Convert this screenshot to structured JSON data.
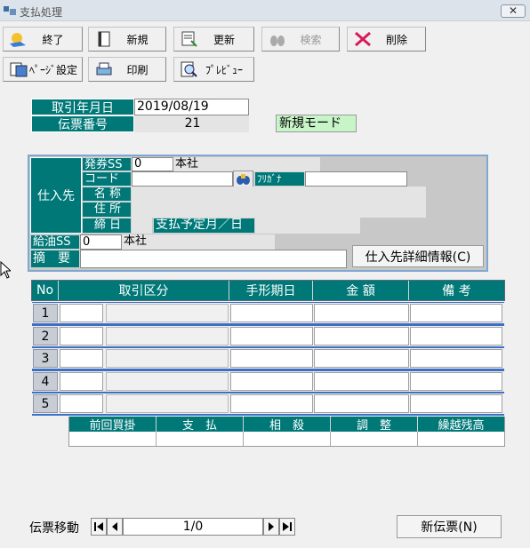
{
  "window": {
    "title": "支払処理",
    "close_label": "✕"
  },
  "toolbar": {
    "exit": "終了",
    "new": "新規",
    "update": "更新",
    "search": "検索",
    "delete": "削除",
    "page_setup": "ﾍﾟｰｼﾞ設定",
    "print": "印刷",
    "preview": "ﾌﾟﾚﾋﾞｭｰ"
  },
  "header": {
    "date_label": "取引年月日",
    "date_value": "2019/08/19",
    "slip_label": "伝票番号",
    "slip_value": "21",
    "mode": "新規モード"
  },
  "supplier": {
    "group_label": "仕入先",
    "issuer_ss_label": "発券SS",
    "issuer_ss_code": "0",
    "issuer_ss_name": "本社",
    "code_label": "コード",
    "code_value": "",
    "furigana_label": "ﾌﾘｶﾞﾅ",
    "furigana_value": "",
    "name_label": "名 称",
    "name_value": "",
    "address_label": "住 所",
    "address_value": "",
    "closing_label": "締 日",
    "closing_value": "",
    "payment_month_label": "支払予定月／日",
    "payment_month_value": "",
    "fuel_ss_label": "給油SS",
    "fuel_ss_code": "0",
    "fuel_ss_name": "本社",
    "memo_label": "摘　要",
    "memo_value": "",
    "detail_button": "仕入先詳細情報(C)"
  },
  "grid": {
    "headers": [
      "No",
      "取引区分",
      "手形期日",
      "金 額",
      "備 考"
    ],
    "rows": [
      {
        "no": "1"
      },
      {
        "no": "2"
      },
      {
        "no": "3"
      },
      {
        "no": "4"
      },
      {
        "no": "5"
      }
    ]
  },
  "totals": {
    "headers": [
      "前回買掛",
      "支　払",
      "相　殺",
      "調　整",
      "繰越残高"
    ]
  },
  "footer": {
    "nav_label": "伝票移動",
    "position": "1/0",
    "new_slip_button": "新伝票(N)"
  },
  "colors": {
    "teal": "#007878",
    "mode_bg": "#c8f5c8",
    "panel_border": "#7fa7d0"
  }
}
